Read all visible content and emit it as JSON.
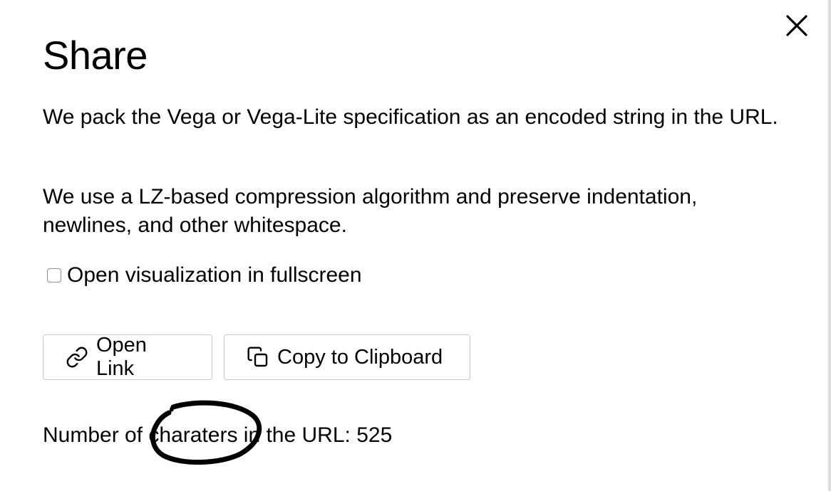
{
  "dialog": {
    "title": "Share",
    "close_icon": "close-icon",
    "paragraphs": [
      "We pack the Vega or Vega-Lite specification as an encoded string in the URL.",
      "We use a LZ-based compression algorithm and preserve indentation, newlines, and other whitespace."
    ],
    "fullscreen_option": {
      "label": "Open visualization in fullscreen",
      "checked": false
    },
    "buttons": {
      "open_link": {
        "label": "Open Link",
        "icon": "link-icon"
      },
      "copy": {
        "label": "Copy to Clipboard",
        "icon": "copy-icon"
      }
    },
    "char_count": {
      "prefix": "Number of ",
      "word": "charaters",
      "suffix": " in the URL: ",
      "value": "525"
    }
  },
  "annotation": {
    "type": "hand-drawn-circle",
    "color": "#000000"
  }
}
